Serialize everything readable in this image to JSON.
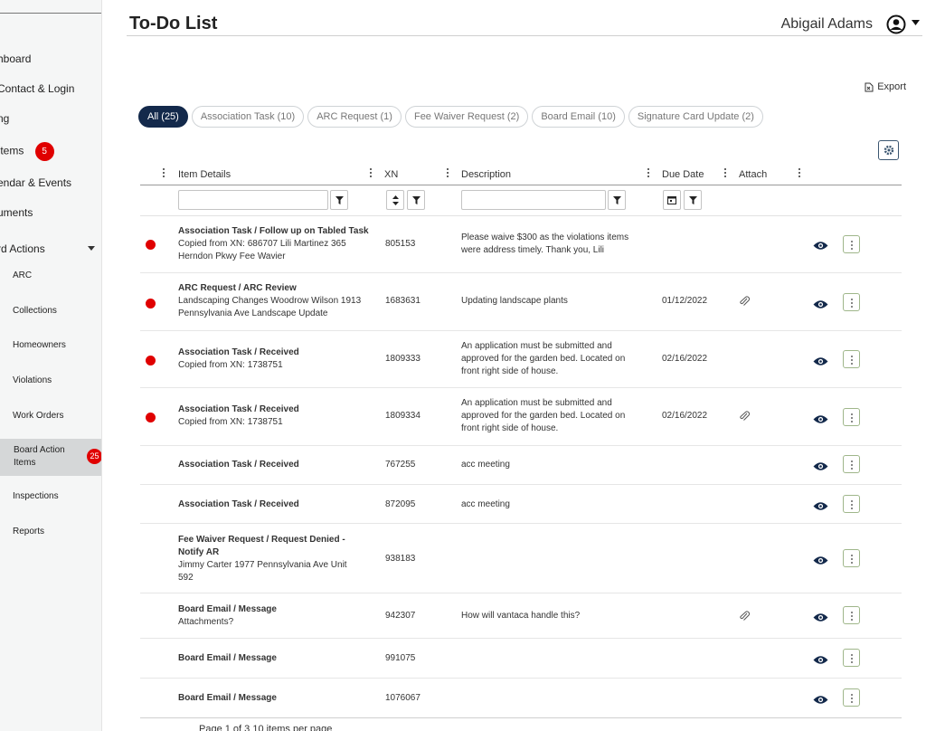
{
  "sidebar": {
    "items": [
      {
        "label": "hboard"
      },
      {
        "label": "Contact & Login"
      },
      {
        "label": "ng"
      },
      {
        "label": "Items",
        "badge": "5"
      },
      {
        "label": "endar & Events"
      },
      {
        "label": "uments"
      },
      {
        "label": "rd Actions"
      }
    ],
    "subitems": [
      {
        "label": "ARC"
      },
      {
        "label": "Collections"
      },
      {
        "label": "Homeowners"
      },
      {
        "label": "Violations"
      },
      {
        "label": "Work Orders"
      },
      {
        "label_line1": "Board Action",
        "label_line2": "Items",
        "badge": "25"
      },
      {
        "label": "Inspections"
      },
      {
        "label": "Reports"
      }
    ]
  },
  "header": {
    "title": "To-Do List",
    "user": "Abigail Adams"
  },
  "toolbar": {
    "export_label": "Export"
  },
  "chips": [
    {
      "label": "All (25)",
      "active": true
    },
    {
      "label": "Association Task (10)"
    },
    {
      "label": "ARC Request (1)"
    },
    {
      "label": "Fee Waiver Request (2)"
    },
    {
      "label": "Board Email (10)"
    },
    {
      "label": "Signature Card Update (2)"
    }
  ],
  "columns": {
    "details": "Item Details",
    "xn": "XN",
    "description": "Description",
    "due": "Due Date",
    "attach": "Attach"
  },
  "rows": [
    {
      "title": "Association Task / Follow up on Tabled Task",
      "sub": "Copied from XN: 686707 Lili Martinez 365 Herndon Pkwy Fee Wavier",
      "xn": "805153",
      "desc": "Please waive $300 as the violations items were address timely. Thank you, Lili",
      "due": "",
      "attach": false,
      "flag": true
    },
    {
      "title": "ARC Request / ARC Review",
      "sub": "Landscaping Changes Woodrow Wilson 1913 Pennsylvania Ave Landscape Update",
      "xn": "1683631",
      "desc": "Updating landscape plants",
      "due": "01/12/2022",
      "attach": true,
      "flag": true
    },
    {
      "title": "Association Task / Received",
      "sub": "Copied from XN: 1738751",
      "xn": "1809333",
      "desc": "An application must be submitted and approved for the garden bed. Located on front right side of house.",
      "due": "02/16/2022",
      "attach": false,
      "flag": true
    },
    {
      "title": "Association Task / Received",
      "sub": "Copied from XN: 1738751",
      "xn": "1809334",
      "desc": "An application must be submitted and approved for the garden bed. Located on front right side of house.",
      "due": "02/16/2022",
      "attach": true,
      "flag": true
    },
    {
      "title": "Association Task / Received",
      "sub": "",
      "xn": "767255",
      "desc": "acc meeting",
      "due": "",
      "attach": false,
      "flag": false
    },
    {
      "title": "Association Task / Received",
      "sub": "",
      "xn": "872095",
      "desc": "acc meeting",
      "due": "",
      "attach": false,
      "flag": false
    },
    {
      "title": "Fee Waiver Request / Request Denied - Notify AR",
      "sub": "Jimmy Carter 1977 Pennsylvania Ave Unit 592",
      "xn": "938183",
      "desc": "",
      "due": "",
      "attach": false,
      "flag": false
    },
    {
      "title": "Board Email / Message",
      "sub": "Attachments?",
      "xn": "942307",
      "desc": "How will vantaca handle this?",
      "due": "",
      "attach": true,
      "flag": false
    },
    {
      "title": "Board Email / Message",
      "sub": "",
      "xn": "991075",
      "desc": "",
      "due": "",
      "attach": false,
      "flag": false
    },
    {
      "title": "Board Email / Message",
      "sub": "",
      "xn": "1076067",
      "desc": "",
      "due": "",
      "attach": false,
      "flag": false
    }
  ],
  "pager": {
    "text": "Page  1  of 3      10    items per page"
  },
  "colors": {
    "accent": "#13294b",
    "flag": "#e00000",
    "badge": "#e00000"
  }
}
